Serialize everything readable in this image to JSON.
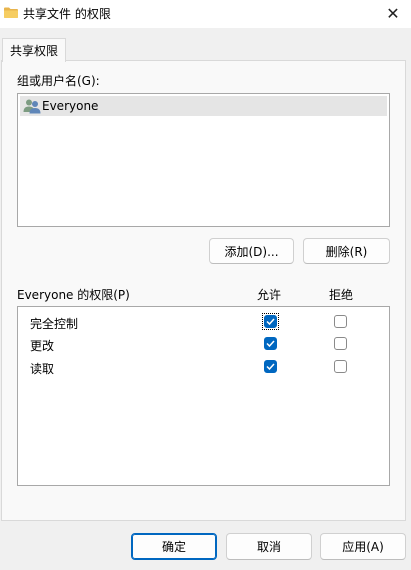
{
  "window": {
    "title": "共享文件 的权限",
    "close_symbol": "✕"
  },
  "tabs": [
    {
      "label": "共享权限"
    }
  ],
  "groups": {
    "label": "组或用户名(G):",
    "items": [
      {
        "name": "Everyone",
        "icon": "users-icon",
        "selected": true
      }
    ]
  },
  "buttons": {
    "add": "添加(D)...",
    "remove": "删除(R)"
  },
  "permissions": {
    "label": "Everyone 的权限(P)",
    "allow_header": "允许",
    "deny_header": "拒绝",
    "rows": [
      {
        "name": "完全控制",
        "allow": true,
        "deny": false,
        "focused": true
      },
      {
        "name": "更改",
        "allow": true,
        "deny": false,
        "focused": false
      },
      {
        "name": "读取",
        "allow": true,
        "deny": false,
        "focused": false
      }
    ]
  },
  "footer": {
    "ok": "确定",
    "cancel": "取消",
    "apply": "应用(A)"
  },
  "colors": {
    "accent": "#0067c0",
    "panel_bg": "#f9f9f9",
    "dialog_bg": "#f0f0f0"
  }
}
